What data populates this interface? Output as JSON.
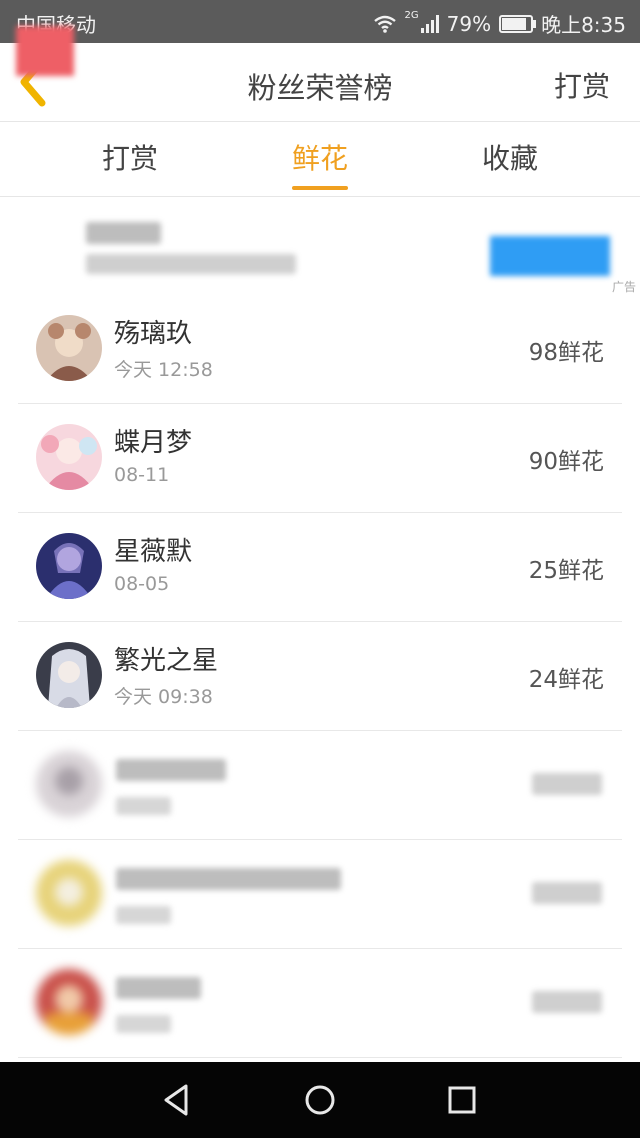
{
  "status_bar": {
    "carrier": "中国移动",
    "network": "2G",
    "battery": "79%",
    "battery_level": 0.79,
    "time": "晚上8:35",
    "icons": [
      "wifi-icon",
      "signal-icon",
      "battery-icon"
    ]
  },
  "header": {
    "title": "粉丝荣誉榜",
    "action": "打赏",
    "back_icon": "chevron-left-icon"
  },
  "tabs": [
    {
      "label": "打赏",
      "active": false
    },
    {
      "label": "鲜花",
      "active": true
    },
    {
      "label": "收藏",
      "active": false
    }
  ],
  "ad": {
    "tag": "广告"
  },
  "rows": [
    {
      "name": "殇璃玖",
      "time": "今天 12:58",
      "count": "98鲜花"
    },
    {
      "name": "蝶月梦",
      "time": "08-11",
      "count": "90鲜花"
    },
    {
      "name": "星薇默",
      "time": "08-05",
      "count": "25鲜花"
    },
    {
      "name": "繁光之星",
      "time": "今天 09:38",
      "count": "24鲜花"
    }
  ],
  "colors": {
    "accent": "#f0a020",
    "status_bar": "#5b5b5b",
    "back_icon": "#f0b400"
  }
}
